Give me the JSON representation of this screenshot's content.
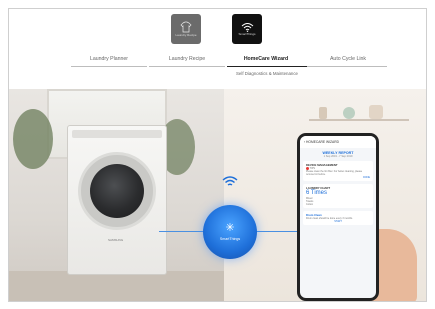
{
  "tabs": [
    {
      "label": "Laundry Planner",
      "active": false
    },
    {
      "label": "Laundry Recipe",
      "active": false
    },
    {
      "label": "HomeCare Wizard",
      "active": true
    },
    {
      "label": "Auto Cycle Link",
      "active": false
    }
  ],
  "icons": [
    {
      "name": "laundry-recipe-icon",
      "caption": "Laundry Recipe",
      "color": "#6b6b6b"
    },
    {
      "name": "smartthings-icon",
      "caption": "SmartThings",
      "color": "#111111"
    }
  ],
  "subtitle": "Self Diagnostics & Maintenance",
  "hub": {
    "label": "SmartThings"
  },
  "dryer": {
    "brand": "SAMSUNG"
  },
  "phone": {
    "header": "HOMECARE WIZARD",
    "report_title": "WEEKLY REPORT",
    "report_date": "1 Sep 2019 - 7 Sep 2019",
    "device_management": {
      "title": "DEVICE MANAGEMENT",
      "badge": "TIPS",
      "text": "Please clean the lint filter. For better cleaning, please remove lint before.",
      "link": "DONE"
    },
    "laundry_chart": {
      "title": "LAUNDRY CHART",
      "count": "6 Times",
      "items": [
        "Mixed",
        "Towels",
        "Cotton"
      ]
    },
    "drum_clean": {
      "title": "Drum Clean",
      "text": "Drum clean should be done every 3 months.",
      "link": "START"
    }
  },
  "colors": {
    "accent": "#1e6fd9",
    "tab_active": "#222222"
  }
}
